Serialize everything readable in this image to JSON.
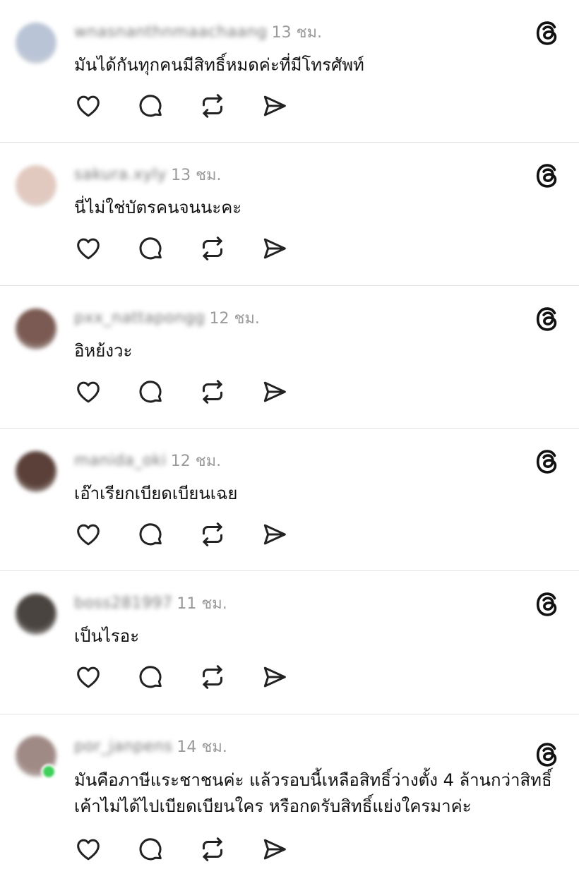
{
  "icons": {
    "platform": "threads-icon",
    "like": "heart-icon",
    "reply": "comment-bubble-icon",
    "repost": "repost-icon",
    "share": "send-icon"
  },
  "colors": {
    "text": "#111111",
    "time": "#9a9a9a",
    "divider": "#e3e3e3",
    "online": "#3fcf5a"
  },
  "posts": [
    {
      "username": "wnasnanthnmaachaang",
      "time": "13 ชม.",
      "text": "มันได้กันทุกคนมีสิทธิ์หมดค่ะที่มีโทรศัพท์",
      "avatar_color": "#b9c4d6"
    },
    {
      "username": "sakura.xyly",
      "time": "13 ชม.",
      "text": "นี่ไม่ใช่บัตรคนจนนะคะ",
      "avatar_color": "#e2c9bf"
    },
    {
      "username": "pxx_nattapongg",
      "time": "12 ชม.",
      "text": "อิหย้งวะ",
      "avatar_color": "#7a5a52"
    },
    {
      "username": "manida_oki",
      "time": "12 ชม.",
      "text": "เอ๊าเรียกเบียดเบียนเฉย",
      "avatar_color": "#5a4038"
    },
    {
      "username": "boss281997",
      "time": "11 ชม.",
      "text": "เป็นไรอะ",
      "avatar_color": "#4a4440"
    },
    {
      "username": "por_janpens",
      "time": "14 ชม.",
      "text": "มันคือภาษีแระชาชนค่ะ แล้วรอบนี้เหลือสิทธิ์ว่างตั้ง 4 ล้านกว่าสิทธิ์ เค้าไม่ได้ไปเบียดเบียนใคร หรือกดรับสิทธิ์แย่งใครมาค่ะ",
      "avatar_color": "#a08a86",
      "online": true
    }
  ]
}
